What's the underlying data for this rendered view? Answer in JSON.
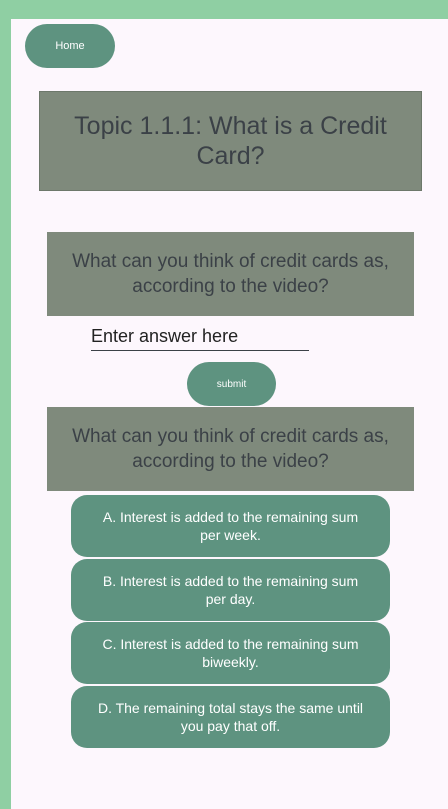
{
  "nav": {
    "home_label": "Home"
  },
  "topic": {
    "title": "Topic 1.1.1: What is a Credit Card?"
  },
  "open_question": {
    "prompt": "What can you think of credit cards as, according to the video?",
    "placeholder": "Enter answer here",
    "submit_label": "submit"
  },
  "multiple_choice": {
    "prompt": "What can you think of credit cards as, according to the video?",
    "options": [
      "A. Interest is added to the remaining sum per week.",
      "B. Interest is added to the remaining sum per day.",
      "C. Interest is added to the remaining sum biweekly.",
      "D. The remaining total stays the same until you pay that off."
    ]
  },
  "colors": {
    "accent": "#5e9380",
    "panel": "#7f8a7c",
    "background": "#fdf7fd",
    "frame": "#8fcfa3"
  }
}
